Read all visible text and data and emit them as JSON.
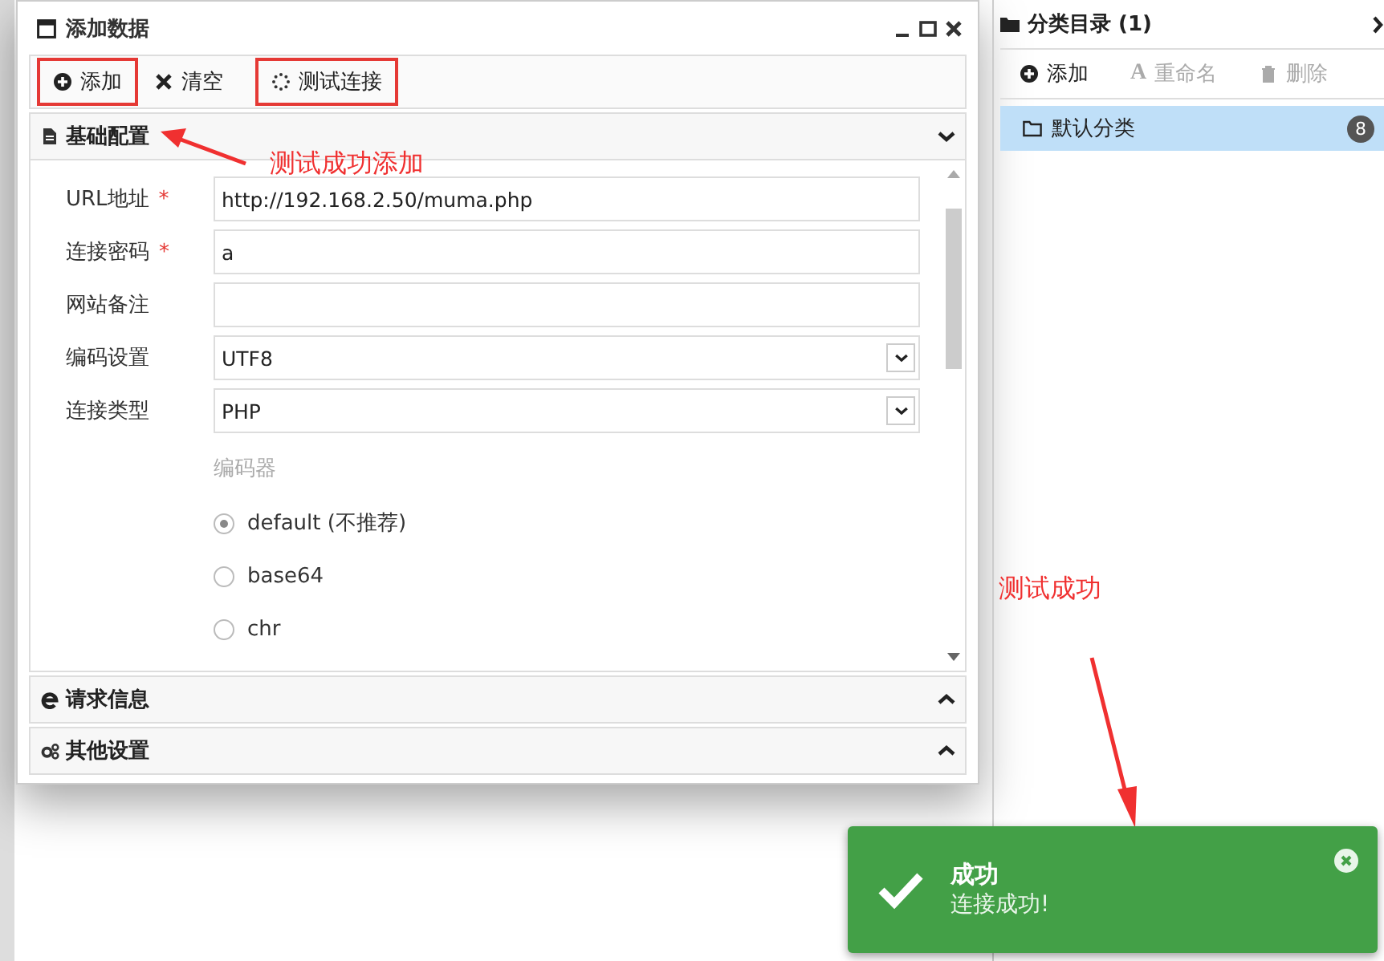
{
  "dialog": {
    "title": "添加数据",
    "toolbar": [
      {
        "label": "添加",
        "kind": "add",
        "highlighted": true
      },
      {
        "label": "清空",
        "kind": "clear",
        "highlighted": false
      },
      {
        "label": "测试连接",
        "kind": "test",
        "highlighted": true
      }
    ],
    "sections": [
      {
        "title": "基础配置",
        "kind": "doc",
        "expanded": true
      },
      {
        "title": "请求信息",
        "kind": "web",
        "expanded": false
      },
      {
        "title": "其他设置",
        "kind": "gears",
        "expanded": false
      }
    ],
    "fields": [
      {
        "label": "URL地址",
        "required_mark": "*",
        "kind": "text",
        "value": "http://192.168.2.50/muma.php"
      },
      {
        "label": "连接密码",
        "required_mark": "*",
        "kind": "text",
        "value": "a"
      },
      {
        "label": "网站备注",
        "kind": "text"
      },
      {
        "label": "编码设置",
        "kind": "select",
        "value": "UTF8"
      },
      {
        "label": "连接类型",
        "kind": "select",
        "value": "PHP"
      }
    ],
    "encoder": {
      "label": "编码器",
      "options": [
        {
          "label": "default (不推荐)",
          "selected": true
        },
        {
          "label": "base64",
          "selected": false
        },
        {
          "label": "chr",
          "selected": false
        }
      ]
    }
  },
  "category_panel": {
    "title": "分类目录 (1)",
    "toolbar": [
      {
        "label": "添加",
        "kind": "add",
        "disabled": false
      },
      {
        "label": "重命名",
        "kind": "rename",
        "icon_char": "A",
        "disabled": true
      },
      {
        "label": "删除",
        "kind": "delete",
        "disabled": true
      }
    ],
    "items": [
      {
        "label": "默认分类",
        "count": "8",
        "selected": true
      }
    ]
  },
  "toast": {
    "title": "成功",
    "message": "连接成功!"
  },
  "annotations": [
    {
      "text": "测试成功添加",
      "kind": "left"
    },
    {
      "text": "测试成功",
      "kind": "down"
    }
  ]
}
